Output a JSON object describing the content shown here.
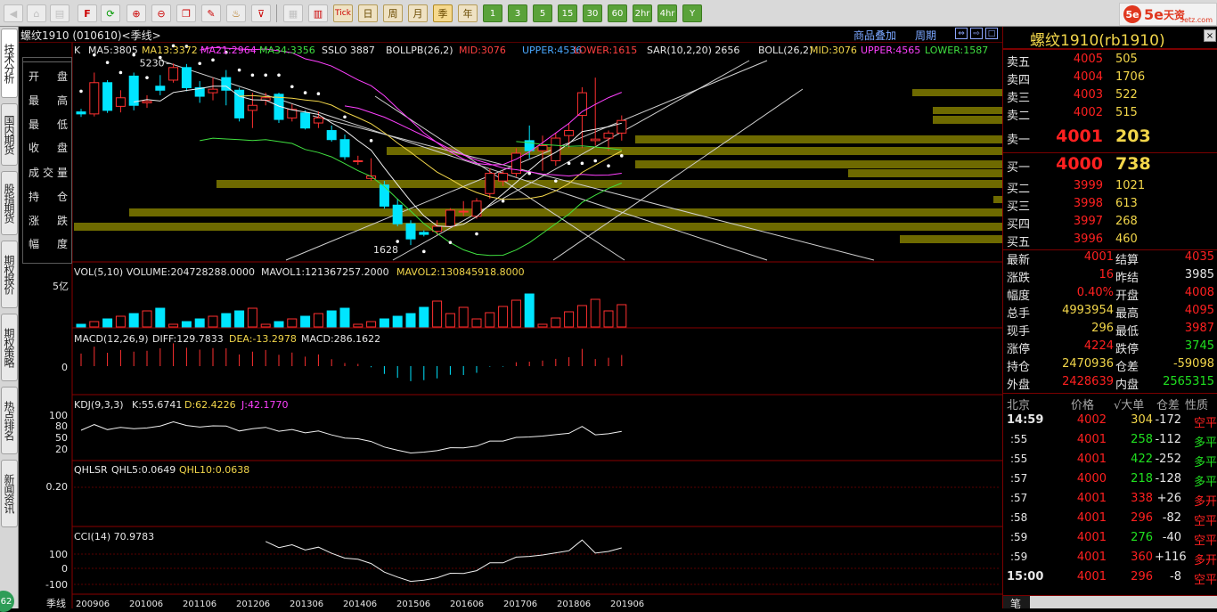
{
  "toolbar": {
    "period_buttons": [
      "日",
      "周",
      "月",
      "季",
      "年",
      "1",
      "3",
      "5",
      "15",
      "30",
      "60",
      "2hr",
      "4hr",
      "Y"
    ],
    "active_period": "季",
    "tick_label": "Tick",
    "logo_main": "5e",
    "logo_cn": "天资",
    "logo_sub": "5etz.com"
  },
  "left_tabs": [
    "技术分析",
    "国内期货",
    "股指期货",
    "期权报价",
    "期权策略",
    "热点排名",
    "新闻资讯"
  ],
  "left_badge": "62",
  "chart_title": "螺纹1910 (010610)<季线>",
  "chart_links": {
    "overlay": "商品叠加",
    "period": "周期"
  },
  "info_box": [
    "开 盘",
    "最 高",
    "最 低",
    "收 盘",
    "成交量",
    "持 仓",
    "涨 跌",
    "幅 度"
  ],
  "main_indicator": {
    "k": "K",
    "ma5": "MA5:3805",
    "ma13": "MA13:3372",
    "ma21": "MA21:2964",
    "ma34": "MA34:3356",
    "sslo": "SSLO 3887",
    "bollpb": "BOLLPB(26,2)",
    "mid": "MID:3076",
    "upper": "UPPER:4536",
    "lower": "LOWER:1615",
    "sar": "SAR(10,2,20) 2656",
    "boll": "BOLL(26,2)",
    "bmid": "MID:3076",
    "bupper": "UPPER:4565",
    "blower": "LOWER:1587",
    "high_label": "5230",
    "low_label": "1628"
  },
  "vol_indicator": {
    "title": "VOL(5,10) VOLUME:204728288.0000",
    "mavol1": "MAVOL1:121367257.2000",
    "mavol2": "MAVOL2:130845918.8000",
    "axis_label": "5亿"
  },
  "macd_indicator": {
    "title": "MACD(12,26,9)",
    "diff": "DIFF:129.7833",
    "dea": "DEA:-13.2978",
    "macd": "MACD:286.1622",
    "axis_label": "0"
  },
  "kdj_indicator": {
    "title": "KDJ(9,3,3)",
    "k": "K:55.6741",
    "d": "D:62.4226",
    "j": "J:42.1770",
    "axis_labels": [
      "100",
      "80",
      "50",
      "20"
    ]
  },
  "qhlsr_indicator": {
    "title": "QHLSR",
    "q5": "QHL5:0.0649",
    "q10": "QHL10:0.0638",
    "axis_label": "0.20"
  },
  "cci_indicator": {
    "title": "CCI(14) 70.9783",
    "axis_labels": [
      "100",
      "0",
      "-100"
    ]
  },
  "x_axis": {
    "period_label": "季线",
    "ticks": [
      "200906",
      "201006",
      "201106",
      "201206",
      "201306",
      "201406",
      "201506",
      "201606",
      "201706",
      "201806",
      "201906"
    ]
  },
  "quote_panel": {
    "name": "螺纹1910(rb1910)",
    "asks": [
      {
        "label": "卖五",
        "price": "4005",
        "vol": "505"
      },
      {
        "label": "卖四",
        "price": "4004",
        "vol": "1706"
      },
      {
        "label": "卖三",
        "price": "4003",
        "vol": "522"
      },
      {
        "label": "卖二",
        "price": "4002",
        "vol": "515"
      },
      {
        "label": "卖一",
        "price": "4001",
        "vol": "203"
      }
    ],
    "bids": [
      {
        "label": "买一",
        "price": "4000",
        "vol": "738"
      },
      {
        "label": "买二",
        "price": "3999",
        "vol": "1021"
      },
      {
        "label": "买三",
        "price": "3998",
        "vol": "613"
      },
      {
        "label": "买四",
        "price": "3997",
        "vol": "268"
      },
      {
        "label": "买五",
        "price": "3996",
        "vol": "460"
      }
    ],
    "stats": [
      {
        "l1": "最新",
        "v1": "4001",
        "c1": "#ff2020",
        "l2": "结算",
        "v2": "4035",
        "c2": "#ff2020"
      },
      {
        "l1": "涨跌",
        "v1": "16",
        "c1": "#ff2020",
        "l2": "昨结",
        "v2": "3985",
        "c2": "#e6e6e6"
      },
      {
        "l1": "幅度",
        "v1": "0.40%",
        "c1": "#ff2020",
        "l2": "开盘",
        "v2": "4008",
        "c2": "#ff2020"
      },
      {
        "l1": "总手",
        "v1": "4993954",
        "c1": "#f2d64a",
        "l2": "最高",
        "v2": "4095",
        "c2": "#ff2020"
      },
      {
        "l1": "现手",
        "v1": "296",
        "c1": "#f2d64a",
        "l2": "最低",
        "v2": "3987",
        "c2": "#ff2020"
      },
      {
        "l1": "涨停",
        "v1": "4224",
        "c1": "#ff2020",
        "l2": "跌停",
        "v2": "3745",
        "c2": "#20e020"
      },
      {
        "l1": "持仓",
        "v1": "2470936",
        "c1": "#f2d64a",
        "l2": "仓差",
        "v2": "-59098",
        "c2": "#f2d64a"
      },
      {
        "l1": "外盘",
        "v1": "2428639",
        "c1": "#ff2020",
        "l2": "内盘",
        "v2": "2565315",
        "c2": "#20e020"
      }
    ],
    "tick_header": {
      "loc": "北京",
      "price": "价格",
      "big": "√大单",
      "diff": "仓差",
      "nature": "性质"
    },
    "ticks": [
      {
        "t": "14:59",
        "p": "4002",
        "v": "304",
        "c": "-172",
        "n": "空平",
        "nc": "#ff2020",
        "big": true
      },
      {
        "t": ":55",
        "p": "4001",
        "v": "258",
        "c": "-112",
        "n": "多平",
        "nc": "#20e020",
        "vc": "#20e020"
      },
      {
        "t": ":55",
        "p": "4001",
        "v": "422",
        "c": "-252",
        "n": "多平",
        "nc": "#20e020",
        "vc": "#20e020"
      },
      {
        "t": ":57",
        "p": "4000",
        "v": "218",
        "c": "-128",
        "n": "多平",
        "nc": "#20e020",
        "vc": "#20e020"
      },
      {
        "t": ":57",
        "p": "4001",
        "v": "338",
        "c": "+26",
        "n": "多开",
        "nc": "#ff2020",
        "vc": "#ff2020"
      },
      {
        "t": ":58",
        "p": "4001",
        "v": "296",
        "c": "-82",
        "n": "空平",
        "nc": "#ff2020",
        "vc": "#ff2020"
      },
      {
        "t": ":59",
        "p": "4001",
        "v": "276",
        "c": "-40",
        "n": "空平",
        "nc": "#ff2020",
        "vc": "#20e020"
      },
      {
        "t": ":59",
        "p": "4001",
        "v": "360",
        "c": "+116",
        "n": "多开",
        "nc": "#ff2020",
        "vc": "#ff2020"
      },
      {
        "t": "15:00",
        "p": "4001",
        "v": "296",
        "c": "-8",
        "n": "空平",
        "nc": "#ff2020",
        "vc": "#ff2020",
        "big": true
      }
    ],
    "bottom_tab": "笔"
  },
  "chart_data": {
    "type": "candlestick",
    "period": "quarterly",
    "x_ticks": [
      "200906",
      "201006",
      "201106",
      "201206",
      "201306",
      "201406",
      "201506",
      "201606",
      "201706",
      "201806",
      "201906"
    ],
    "price_labels": {
      "high": 5230,
      "low": 1628
    },
    "candles": [
      [
        4270,
        4330,
        4170,
        4230
      ],
      [
        4230,
        5050,
        4180,
        4850
      ],
      [
        4850,
        4900,
        4250,
        4300
      ],
      [
        4380,
        4700,
        4260,
        4550
      ],
      [
        4980,
        5050,
        4300,
        4400
      ],
      [
        4450,
        4600,
        4350,
        4480
      ],
      [
        4780,
        5000,
        4600,
        4700
      ],
      [
        4900,
        5230,
        4850,
        5150
      ],
      [
        5150,
        5220,
        4680,
        4750
      ],
      [
        4750,
        4880,
        4450,
        4580
      ],
      [
        4650,
        4950,
        4500,
        4720
      ],
      [
        4950,
        5100,
        4400,
        4700
      ],
      [
        4700,
        4750,
        4080,
        4150
      ],
      [
        4300,
        4650,
        3950,
        4400
      ],
      [
        4500,
        4650,
        4400,
        4550
      ],
      [
        4620,
        4650,
        4050,
        4120
      ],
      [
        4150,
        4420,
        4080,
        4320
      ],
      [
        4250,
        4300,
        3920,
        3950
      ],
      [
        4050,
        4280,
        3950,
        4150
      ],
      [
        3900,
        4000,
        3680,
        3720
      ],
      [
        3720,
        3820,
        3320,
        3380
      ],
      [
        3300,
        3400,
        3220,
        3300
      ],
      [
        2950,
        3350,
        2900,
        3000
      ],
      [
        2820,
        2900,
        2350,
        2400
      ],
      [
        2420,
        2550,
        2000,
        2050
      ],
      [
        2050,
        2120,
        1628,
        1750
      ],
      [
        1880,
        1920,
        1800,
        1840
      ],
      [
        1900,
        2120,
        1830,
        2000
      ],
      [
        2000,
        2360,
        1980,
        2320
      ],
      [
        2300,
        2500,
        2200,
        2300
      ],
      [
        2200,
        2560,
        2150,
        2500
      ],
      [
        2650,
        3150,
        2550,
        3050
      ],
      [
        2900,
        3100,
        2800,
        3050
      ],
      [
        3050,
        3550,
        2980,
        3450
      ],
      [
        3700,
        4000,
        3350,
        3500
      ],
      [
        3500,
        3800,
        3100,
        3600
      ],
      [
        3300,
        3850,
        3200,
        3750
      ],
      [
        3800,
        4050,
        3550,
        3900
      ],
      [
        4200,
        4760,
        3550,
        4650
      ],
      [
        3700,
        4950,
        3600,
        3730
      ],
      [
        3750,
        3900,
        3500,
        3850
      ],
      [
        3850,
        4200,
        3700,
        4100
      ]
    ],
    "volume_hint": "lower panel histogram",
    "indicators": [
      "MA5",
      "MA13",
      "MA21",
      "MA34",
      "SAR",
      "BOLL",
      "VOL",
      "MACD",
      "KDJ",
      "QHLSR",
      "CCI"
    ]
  }
}
